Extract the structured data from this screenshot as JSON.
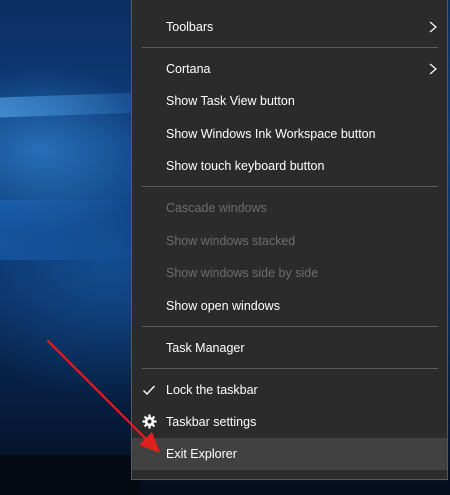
{
  "menu": {
    "toolbars": "Toolbars",
    "cortana": "Cortana",
    "show_task_view": "Show Task View button",
    "show_ink_workspace": "Show Windows Ink Workspace button",
    "show_touch_keyboard": "Show touch keyboard button",
    "cascade_windows": "Cascade windows",
    "show_windows_stacked": "Show windows stacked",
    "show_windows_side_by_side": "Show windows side by side",
    "show_open_windows": "Show open windows",
    "task_manager": "Task Manager",
    "lock_taskbar": "Lock the taskbar",
    "taskbar_settings": "Taskbar settings",
    "exit_explorer": "Exit Explorer"
  },
  "state": {
    "lock_taskbar_checked": true,
    "highlighted_item": "Exit Explorer",
    "disabled_items": [
      "Cascade windows",
      "Show windows stacked",
      "Show windows side by side"
    ]
  },
  "colors": {
    "menu_background": "#2b2b2b",
    "menu_hover": "#414141",
    "disabled_text": "#6d6d6d",
    "annotation_arrow": "#e0201c"
  },
  "icons": [
    "chevron-right-icon",
    "checkmark-icon",
    "gear-icon",
    "annotation-arrow"
  ]
}
